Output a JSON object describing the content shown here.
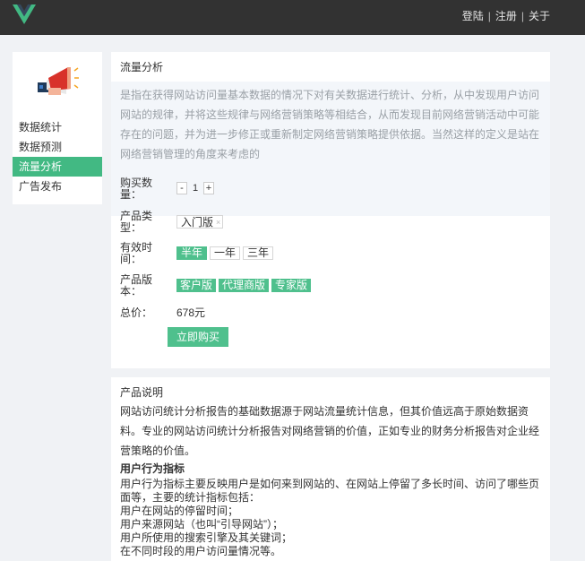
{
  "header": {
    "logo_icon": "vue-logo-icon",
    "nav": [
      "登陆",
      "注册",
      "关于"
    ],
    "separator": "|"
  },
  "sidebar": {
    "icon": "megaphone-icon",
    "items": [
      {
        "label": "数据统计",
        "active": false
      },
      {
        "label": "数据预测",
        "active": false
      },
      {
        "label": "流量分析",
        "active": true
      },
      {
        "label": "广告发布",
        "active": false
      }
    ]
  },
  "main": {
    "title": "流量分析",
    "description": "是指在获得网站访问量基本数据的情况下对有关数据进行统计、分析，从中发现用户访问网站的规律，并将这些规律与网络营销策略等相结合，从而发现目前网络营销活动中可能存在的问题，并为进一步修正或重新制定网络营销策略提供依据。当然这样的定义是站在网络营销管理的角度来考虑的",
    "form": {
      "quantity": {
        "label": "购买数量：",
        "minus": "-",
        "value": "1",
        "plus": "+"
      },
      "product_type": {
        "label": "产品类型：",
        "value": "入门版",
        "clear": "×"
      },
      "duration": {
        "label": "有效时间：",
        "options": [
          "半年",
          "一年",
          "三年"
        ],
        "selected": 0
      },
      "version": {
        "label": "产品版本：",
        "options": [
          "客户版",
          "代理商版",
          "专家版"
        ]
      },
      "total": {
        "label": "总价：",
        "value": "678元"
      },
      "buy_label": "立即购买"
    }
  },
  "info": {
    "title": "产品说明",
    "paragraph": "网站访问统计分析报告的基础数据源于网站流量统计信息，但其价值远高于原始数据资料。专业的网站访问统计分析报告对网络营销的价值，正如专业的财务分析报告对企业经营策略的价值。",
    "heading": "用户行为指标",
    "lines": [
      "用户行为指标主要反映用户是如何来到网站的、在网站上停留了多长时间、访问了哪些页面等，主要的统计指标包括：",
      "用户在网站的停留时间；",
      "用户来源网站（也叫“引导网站”）；",
      "用户所使用的搜索引擎及其关键词；",
      "在不同时段的用户访问量情况等。"
    ]
  },
  "colors": {
    "accent": "#4fc08d",
    "topbar": "#323232",
    "background": "#f0f2f5"
  }
}
